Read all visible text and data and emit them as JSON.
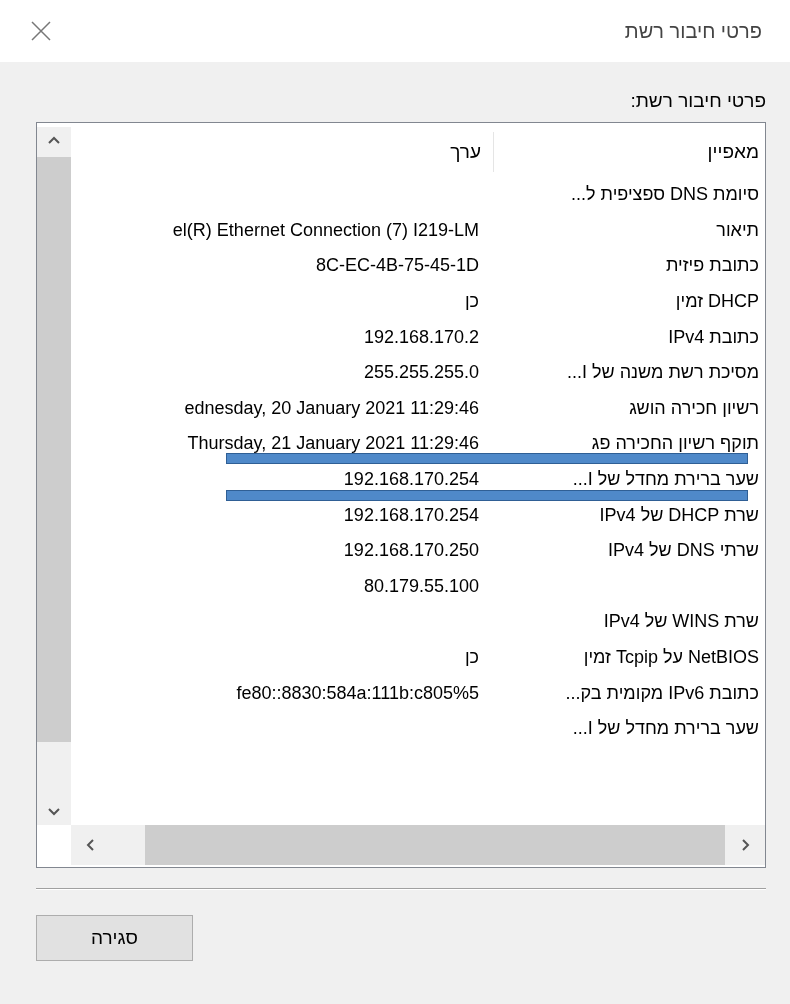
{
  "window": {
    "title": "פרטי חיבור רשת"
  },
  "section_label": "פרטי חיבור רשת:",
  "table": {
    "columns": [
      "מאפיין",
      "ערך"
    ],
    "rows": [
      {
        "property": "סיומת DNS ספציפית ל..."
      },
      {
        "property": "תיאור",
        "value": "el(R) Ethernet Connection (7) I219-LM"
      },
      {
        "property": "כתובת פיזית",
        "value": "8C-EC-4B-75-45-1D"
      },
      {
        "property": "DHCP זמין",
        "value": "כן"
      },
      {
        "property": "כתובת IPv4",
        "value": "192.168.170.2"
      },
      {
        "property": "מסיכת רשת משנה של I...",
        "value": "255.255.255.0"
      },
      {
        "property": "רשיון חכירה הושג",
        "value": "ednesday, 20 January 2021 11:29:46"
      },
      {
        "property": "תוקף רשיון החכירה פג",
        "value": "Thursday, 21 January 2021 11:29:46"
      },
      {
        "property": "שער ברירת מחדל של I...",
        "value": "192.168.170.254"
      },
      {
        "property": "שרת DHCP של IPv4",
        "value": "192.168.170.254"
      },
      {
        "property": "שרתי DNS של IPv4",
        "value": "192.168.170.250"
      },
      {
        "value": "80.179.55.100"
      },
      {
        "property": "שרת WINS של IPv4"
      },
      {
        "property": "NetBIOS על Tcpip זמין",
        "value": "כן"
      },
      {
        "property": "כתובת IPv6 מקומית בק...",
        "value": "fe80::8830:584a:111b:c805%5"
      },
      {
        "property": "שער ברירת מחדל של I..."
      }
    ]
  },
  "buttons": [
    "סגירה"
  ]
}
